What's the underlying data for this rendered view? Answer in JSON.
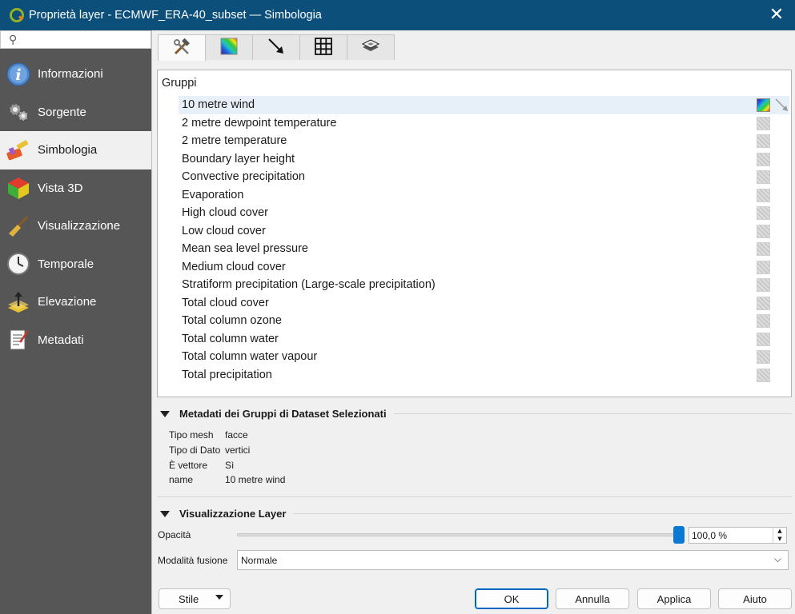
{
  "window": {
    "title": "Proprietà layer - ECMWF_ERA-40_subset — Simbologia",
    "close_glyph": "✕"
  },
  "sidebar": {
    "search_glyph": "⚲",
    "items": [
      {
        "label": "Informazioni",
        "icon": "info-icon"
      },
      {
        "label": "Sorgente",
        "icon": "source-gears-icon"
      },
      {
        "label": "Simbologia",
        "icon": "paintbrush-icon"
      },
      {
        "label": "Vista 3D",
        "icon": "cube-3d-icon"
      },
      {
        "label": "Visualizzazione",
        "icon": "broom-brush-icon"
      },
      {
        "label": "Temporale",
        "icon": "clock-icon"
      },
      {
        "label": "Elevazione",
        "icon": "elevation-icon"
      },
      {
        "label": "Metadati",
        "icon": "metadata-document-icon"
      }
    ],
    "active_index": 2
  },
  "tabs": [
    {
      "icon": "hammer-wrench-icon"
    },
    {
      "icon": "color-ramp-icon"
    },
    {
      "icon": "vector-arrow-icon"
    },
    {
      "icon": "mesh-grid-icon"
    },
    {
      "icon": "layer-render-icon"
    }
  ],
  "groups": {
    "header": "Gruppi",
    "items": [
      "10 metre wind",
      "2 metre dewpoint temperature",
      "2 metre temperature",
      "Boundary layer height",
      "Convective precipitation",
      "Evaporation",
      "High cloud cover",
      "Low cloud cover",
      "Mean sea level pressure",
      "Medium cloud cover",
      "Stratiform precipitation (Large-scale precipitation)",
      "Total cloud cover",
      "Total column ozone",
      "Total column water",
      "Total column water vapour",
      "Total precipitation"
    ],
    "selected_index": 0
  },
  "metadata": {
    "title": "Metadati dei Gruppi di Dataset Selezionati",
    "rows": [
      {
        "key": "Tipo mesh",
        "value": "facce"
      },
      {
        "key": "Tipo di Dato",
        "value": "vertici"
      },
      {
        "key": "È vettore",
        "value": "Sì"
      },
      {
        "key": "name",
        "value": "10 metre wind"
      }
    ]
  },
  "layer_rendering": {
    "title": "Visualizzazione Layer",
    "opacity_label": "Opacità",
    "opacity_value": "100,0 %",
    "opacity_fraction": 1.0,
    "blend_label": "Modalità fusione",
    "blend_value": "Normale"
  },
  "buttons": {
    "style": "Stile",
    "ok": "OK",
    "cancel": "Annulla",
    "apply": "Applica",
    "help": "Aiuto"
  },
  "colors": {
    "titlebar": "#0b4f7a",
    "sidebar": "#565656",
    "accent": "#0a78d4"
  }
}
